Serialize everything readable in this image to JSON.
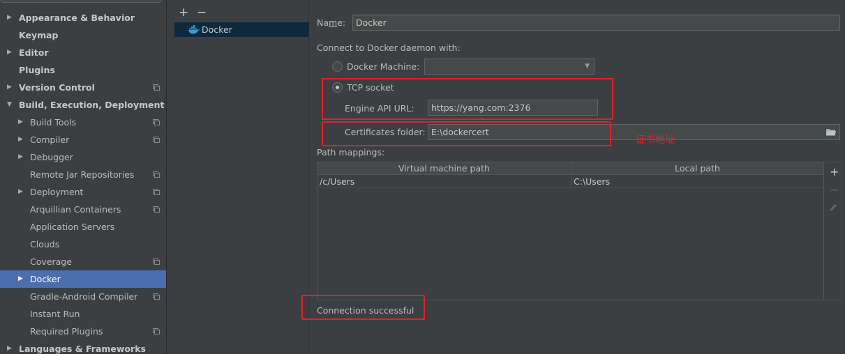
{
  "sidebar": {
    "items": [
      {
        "label": "Appearance & Behavior",
        "level": 0,
        "arrow": true,
        "bold": true,
        "project_icon": false
      },
      {
        "label": "Keymap",
        "level": 0,
        "arrow": false,
        "bold": true,
        "project_icon": false
      },
      {
        "label": "Editor",
        "level": 0,
        "arrow": true,
        "bold": true,
        "project_icon": false
      },
      {
        "label": "Plugins",
        "level": 0,
        "arrow": false,
        "bold": true,
        "project_icon": false
      },
      {
        "label": "Version Control",
        "level": 0,
        "arrow": true,
        "bold": true,
        "project_icon": true
      },
      {
        "label": "Build, Execution, Deployment",
        "level": 0,
        "arrow": true,
        "expanded": true,
        "bold": true,
        "project_icon": false
      },
      {
        "label": "Build Tools",
        "level": 1,
        "arrow": true,
        "bold": false,
        "project_icon": true
      },
      {
        "label": "Compiler",
        "level": 1,
        "arrow": true,
        "bold": false,
        "project_icon": true
      },
      {
        "label": "Debugger",
        "level": 1,
        "arrow": true,
        "bold": false,
        "project_icon": false
      },
      {
        "label": "Remote Jar Repositories",
        "level": 1,
        "arrow": false,
        "bold": false,
        "project_icon": true
      },
      {
        "label": "Deployment",
        "level": 1,
        "arrow": true,
        "bold": false,
        "project_icon": true
      },
      {
        "label": "Arquillian Containers",
        "level": 1,
        "arrow": false,
        "bold": false,
        "project_icon": true
      },
      {
        "label": "Application Servers",
        "level": 1,
        "arrow": false,
        "bold": false,
        "project_icon": false
      },
      {
        "label": "Clouds",
        "level": 1,
        "arrow": false,
        "bold": false,
        "project_icon": false
      },
      {
        "label": "Coverage",
        "level": 1,
        "arrow": false,
        "bold": false,
        "project_icon": true
      },
      {
        "label": "Docker",
        "level": 1,
        "arrow": true,
        "bold": false,
        "project_icon": false,
        "selected": true
      },
      {
        "label": "Gradle-Android Compiler",
        "level": 1,
        "arrow": false,
        "bold": false,
        "project_icon": true
      },
      {
        "label": "Instant Run",
        "level": 1,
        "arrow": false,
        "bold": false,
        "project_icon": false
      },
      {
        "label": "Required Plugins",
        "level": 1,
        "arrow": false,
        "bold": false,
        "project_icon": true
      },
      {
        "label": "Languages & Frameworks",
        "level": 0,
        "arrow": true,
        "bold": true,
        "project_icon": false
      }
    ]
  },
  "middle": {
    "add_symbol": "+",
    "remove_symbol": "−",
    "docker_item_label": "Docker"
  },
  "config": {
    "name_label_pre": "Na",
    "name_label_mnemonic": "m",
    "name_label_post": "e:",
    "name_value": "Docker",
    "connect_label": "Connect to Docker daemon with:",
    "docker_machine_label": "Docker Machine:",
    "docker_machine_value": "",
    "tcp_socket_label": "TCP socket",
    "engine_api_label": "Engine API URL:",
    "engine_api_value": "https://yang.com:2376",
    "certs_label": "Certificates folder:",
    "certs_value": "E:\\dockercert",
    "path_mappings_label": "Path mappings:",
    "table": {
      "columns": [
        "Virtual machine path",
        "Local path"
      ],
      "rows": [
        [
          "/c/Users",
          "C:\\Users"
        ]
      ]
    },
    "status": "Connection successful",
    "selected_connection": "TCP socket"
  },
  "annotation": "证书地址",
  "colors": {
    "background": "#3c3f41",
    "selection": "#4b6eaf",
    "annotation_red": "#e0212b",
    "docker_blue": "#3a9ad9"
  }
}
